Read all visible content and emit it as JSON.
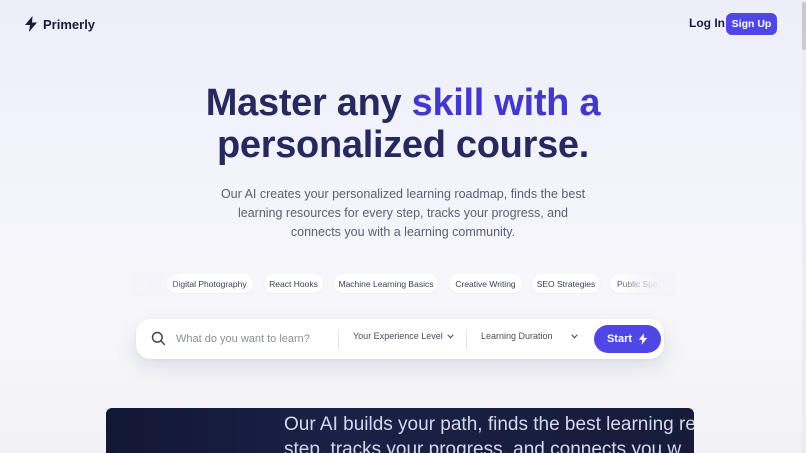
{
  "brand": {
    "name": "Primerly",
    "icon": "lightning-bolt-icon"
  },
  "nav": {
    "login_label": "Log In",
    "signup_label": "Sign Up"
  },
  "hero": {
    "title_part1": "Master any",
    "title_part2": "skill with a",
    "title_part3": "personalized course.",
    "subtitle_line1": "Our AI creates your personalized learning roadmap, finds the best",
    "subtitle_line2": "learning resources for every step, tracks your progress, and",
    "subtitle_line3": "connects you with a learning community."
  },
  "topics": [
    "Digital Photography",
    "React Hooks",
    "Machine Learning Basics",
    "Creative Writing",
    "SEO Strategies",
    "Public Spe"
  ],
  "search": {
    "placeholder": "What do you want to learn?",
    "experience_label": "Your Experience Level",
    "duration_label": "Learning Duration",
    "start_label": "Start"
  },
  "video": {
    "line1": "Our AI builds your path, finds the best learning res",
    "line2": "step, tracks your progress, and connects you w"
  },
  "colors": {
    "accent": "#4f46e5",
    "title_dark": "#27285e",
    "title_light": "#4338ca"
  }
}
